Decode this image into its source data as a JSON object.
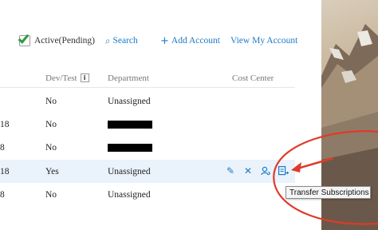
{
  "toolbar": {
    "active_label": "Active(Pending)",
    "search_label": "Search",
    "add_account_label": "Add Account",
    "view_account_label": "View My Account"
  },
  "table": {
    "headers": {
      "dev_test": "Dev/Test",
      "department": "Department",
      "cost_center": "Cost Center"
    },
    "rows": [
      {
        "id_fragment": "",
        "dev_test": "No",
        "department": "Unassigned",
        "redacted": false
      },
      {
        "id_fragment": "18",
        "dev_test": "No",
        "department": "",
        "redacted": true
      },
      {
        "id_fragment": "8",
        "dev_test": "No",
        "department": "",
        "redacted": true
      },
      {
        "id_fragment": "18",
        "dev_test": "Yes",
        "department": "Unassigned",
        "redacted": false
      },
      {
        "id_fragment": "8",
        "dev_test": "No",
        "department": "Unassigned",
        "redacted": false
      }
    ]
  },
  "row_actions": {
    "edit": "edit-icon",
    "delete": "close-icon",
    "user": "user-icon",
    "transfer": "transfer-icon"
  },
  "tooltip": {
    "text": "Transfer Subscriptions"
  },
  "colors": {
    "accent": "#1d7ac7",
    "check": "#2e9b3e",
    "annotation": "#e03a2a",
    "highlight_row": "#eaf3fb"
  }
}
